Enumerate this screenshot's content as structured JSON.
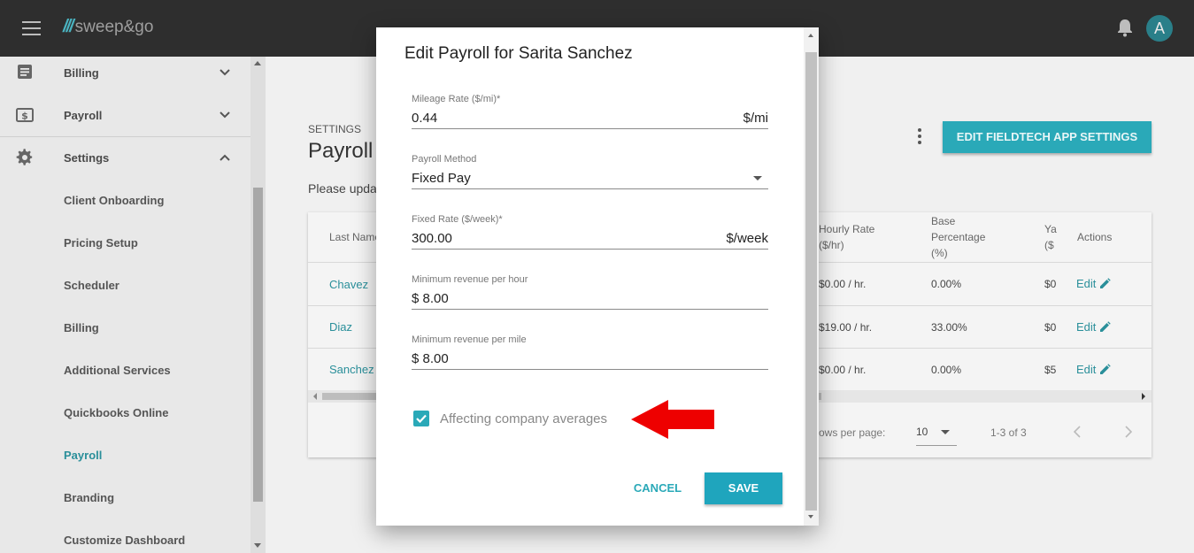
{
  "app": {
    "logo_text": "sweep&go",
    "avatar_letter": "A"
  },
  "sidebar": {
    "groups": [
      {
        "label": "Billing",
        "icon": "billing-icon"
      },
      {
        "label": "Payroll",
        "icon": "payroll-icon"
      },
      {
        "label": "Settings",
        "icon": "gear-icon"
      }
    ],
    "settings_items": [
      {
        "label": "Client Onboarding"
      },
      {
        "label": "Pricing Setup"
      },
      {
        "label": "Scheduler"
      },
      {
        "label": "Billing"
      },
      {
        "label": "Additional Services"
      },
      {
        "label": "Quickbooks Online"
      },
      {
        "label": "Payroll",
        "active": true
      },
      {
        "label": "Branding"
      },
      {
        "label": "Customize Dashboard"
      }
    ]
  },
  "main": {
    "section": "SETTINGS",
    "title": "Payroll",
    "hint": "Please upda",
    "edit_app_button": "EDIT FIELDTECH APP SETTINGS",
    "table": {
      "headers": {
        "last_name": "Last Name",
        "hourly_rate_1": "Hourly Rate",
        "hourly_rate_2": "($/hr)",
        "base_1": "Base",
        "base_2": "Percentage",
        "base_3": "(%)",
        "ya_1": "Ya",
        "ya_2": "($",
        "actions": "Actions"
      },
      "rows": [
        {
          "last_name": "Chavez",
          "hourly": "$0.00 / hr.",
          "base": "0.00%",
          "ya": "$0",
          "action": "Edit"
        },
        {
          "last_name": "Diaz",
          "hourly": "$19.00 / hr.",
          "base": "33.00%",
          "ya": "$0",
          "action": "Edit"
        },
        {
          "last_name": "Sanchez",
          "hourly": "$0.00 / hr.",
          "base": "0.00%",
          "ya": "$5",
          "action": "Edit"
        }
      ],
      "rows_per_page_label": "ows per page:",
      "rows_per_page": "10",
      "range": "1-3 of 3"
    }
  },
  "dialog": {
    "title": "Edit Payroll for Sarita Sanchez",
    "fields": {
      "mileage": {
        "label": "Mileage Rate ($/mi)*",
        "value": "0.44",
        "suffix": "$/mi"
      },
      "method": {
        "label": "Payroll Method",
        "value": "Fixed Pay"
      },
      "fixed": {
        "label": "Fixed Rate ($/week)*",
        "value": "300.00",
        "suffix": "$/week"
      },
      "min_hour": {
        "label": "Minimum revenue per hour",
        "value": "$ 8.00"
      },
      "min_mile": {
        "label": "Minimum revenue per mile",
        "value": "$ 8.00"
      }
    },
    "checkbox_label": "Affecting company averages",
    "checkbox_checked": true,
    "cancel_label": "CANCEL",
    "save_label": "SAVE"
  }
}
